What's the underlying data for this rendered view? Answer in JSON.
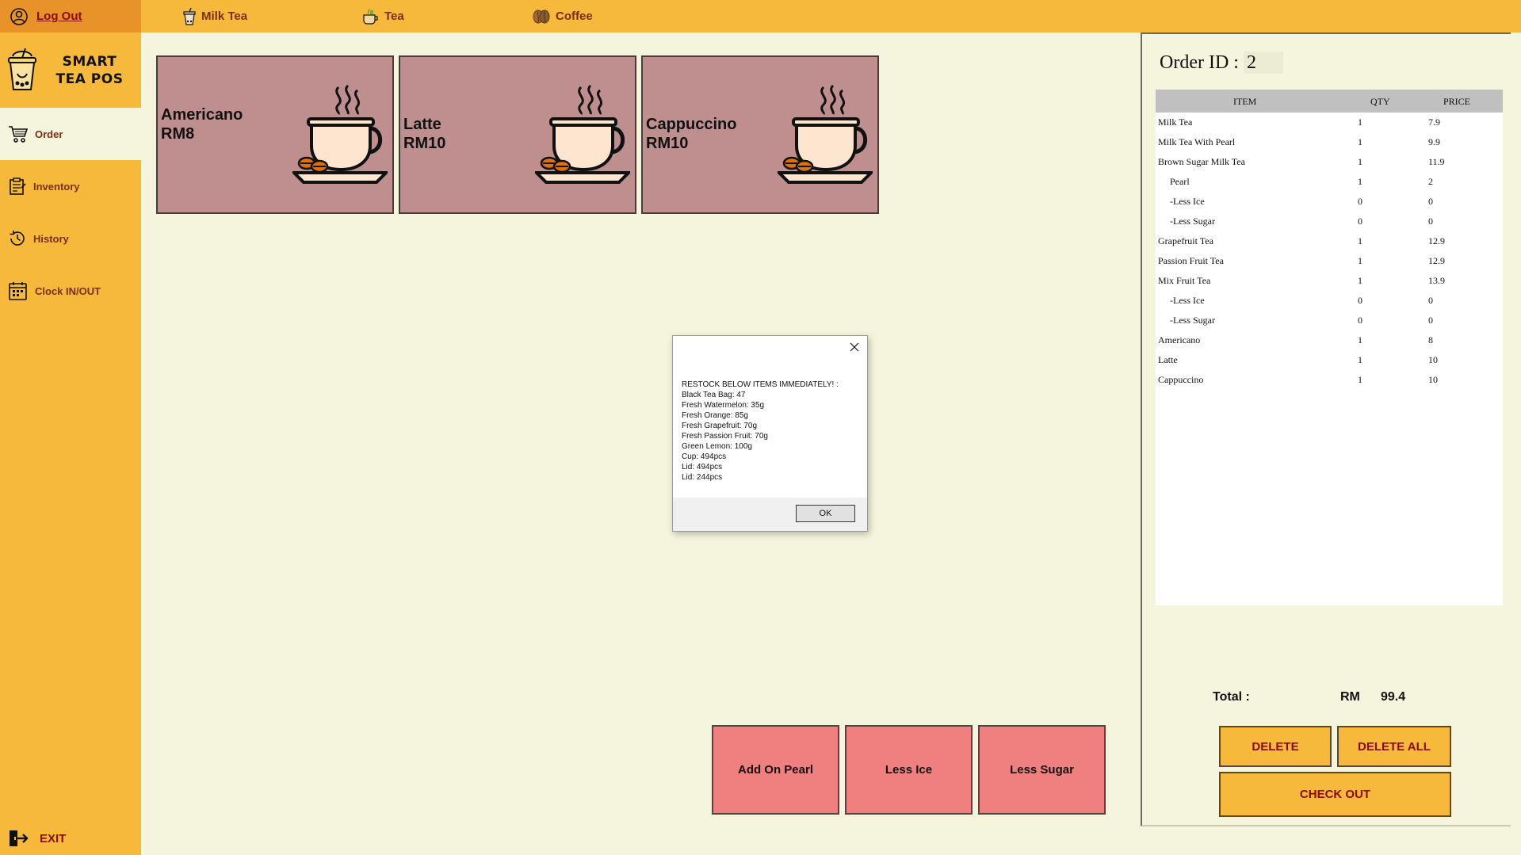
{
  "sidebar": {
    "logout_label": "Log Out",
    "logo_text": "SMART TEA POS",
    "items": [
      {
        "label": "Order",
        "icon": "cart-icon"
      },
      {
        "label": "Inventory",
        "icon": "clipboard-icon"
      },
      {
        "label": "History",
        "icon": "history-icon"
      },
      {
        "label": "Clock IN/OUT",
        "icon": "calendar-icon"
      }
    ],
    "active_item": "Order",
    "exit_label": "EXIT"
  },
  "categories": [
    {
      "label": "Milk Tea",
      "icon": "milk-tea-icon"
    },
    {
      "label": "Tea",
      "icon": "tea-icon"
    },
    {
      "label": "Coffee",
      "icon": "coffee-bean-icon"
    }
  ],
  "products": [
    {
      "name": "Americano",
      "price": "RM8"
    },
    {
      "name": "Latte",
      "price": "RM10"
    },
    {
      "name": "Cappuccino",
      "price": "RM10"
    }
  ],
  "addons": [
    {
      "label": "Add On Pearl"
    },
    {
      "label": "Less Ice"
    },
    {
      "label": "Less Sugar"
    }
  ],
  "order": {
    "id_label": "Order ID :",
    "id_value": "2",
    "columns": [
      "ITEM",
      "QTY",
      "PRICE"
    ],
    "rows": [
      {
        "item": "Milk Tea",
        "qty": "1",
        "price": "7.9"
      },
      {
        "item": "Milk Tea With Pearl",
        "qty": "1",
        "price": "9.9"
      },
      {
        "item": "Brown Sugar Milk Tea",
        "qty": "1",
        "price": "11.9"
      },
      {
        "item": "Pearl",
        "qty": "1",
        "price": "2"
      },
      {
        "item": "-Less Ice",
        "qty": "0",
        "price": "0"
      },
      {
        "item": "-Less Sugar",
        "qty": "0",
        "price": "0"
      },
      {
        "item": "Grapefruit Tea",
        "qty": "1",
        "price": "12.9"
      },
      {
        "item": "Passion Fruit Tea",
        "qty": "1",
        "price": "12.9"
      },
      {
        "item": "Mix Fruit Tea",
        "qty": "1",
        "price": "13.9"
      },
      {
        "item": "-Less Ice",
        "qty": "0",
        "price": "0"
      },
      {
        "item": "-Less Sugar",
        "qty": "0",
        "price": "0"
      },
      {
        "item": "Americano",
        "qty": "1",
        "price": "8"
      },
      {
        "item": "Latte",
        "qty": "1",
        "price": "10"
      },
      {
        "item": "Cappuccino",
        "qty": "1",
        "price": "10"
      }
    ],
    "total_label": "Total :",
    "currency": "RM",
    "total_value": "99.4",
    "delete_label": "DELETE",
    "delete_all_label": "DELETE ALL",
    "checkout_label": "CHECK OUT"
  },
  "dialog": {
    "lines": [
      "RESTOCK BELOW ITEMS IMMEDIATELY! :",
      "Black Tea Bag: 47",
      "Fresh Watermelon: 35g",
      "Fresh Orange: 85g",
      "Fresh Grapefruit: 70g",
      "Fresh Passion Fruit: 70g",
      "Green Lemon: 100g",
      "Cup: 494pcs",
      "Lid: 494pcs",
      "Lid: 244pcs"
    ],
    "ok_label": "OK"
  },
  "colors": {
    "sidebar": "#f7b93c",
    "background": "#f5f4dc",
    "product_tile": "#bf8f8f",
    "addon_button": "#f08080",
    "accent_text": "#8a0a0a"
  }
}
